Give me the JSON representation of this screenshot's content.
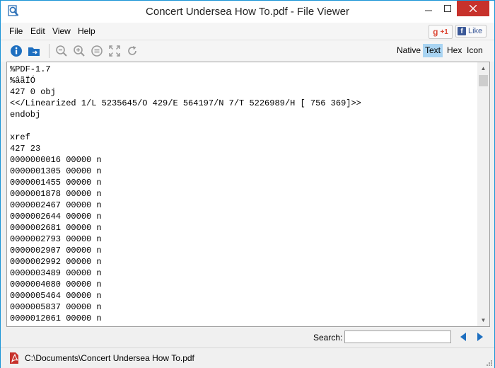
{
  "window": {
    "title": "Concert Undersea How To.pdf - File Viewer"
  },
  "titlebar_buttons": {
    "minimize": "—",
    "maximize": "☐",
    "close": "✕"
  },
  "menu": [
    "File",
    "Edit",
    "View",
    "Help"
  ],
  "social": {
    "gplus_label": "+1",
    "gplus_letter": "g",
    "facebook_label": "Like",
    "facebook_letter": "f"
  },
  "toolbar": {
    "icons": [
      "info-icon",
      "open-folder-icon",
      "zoom-out-icon",
      "zoom-in-icon",
      "zoom-reset-icon",
      "fit-to-window-icon",
      "rotate-icon"
    ],
    "view_tabs": [
      "Native",
      "Text",
      "Hex",
      "Icon"
    ],
    "active_view": "Text"
  },
  "content": {
    "lines": [
      "%PDF-1.7",
      "%âãÏÓ",
      "427 0 obj",
      "<</Linearized 1/L 5235645/O 429/E 564197/N 7/T 5226989/H [ 756 369]>>",
      "endobj",
      "",
      "xref",
      "427 23",
      "0000000016 00000 n",
      "0000001305 00000 n",
      "0000001455 00000 n",
      "0000001878 00000 n",
      "0000002467 00000 n",
      "0000002644 00000 n",
      "0000002681 00000 n",
      "0000002793 00000 n",
      "0000002907 00000 n",
      "0000002992 00000 n",
      "0000003489 00000 n",
      "0000004080 00000 n",
      "0000005464 00000 n",
      "0000005837 00000 n",
      "0000012061 00000 n"
    ]
  },
  "search": {
    "label": "Search:",
    "value": "",
    "placeholder": ""
  },
  "status": {
    "path": "C:\\Documents\\Concert Undersea How To.pdf"
  },
  "colors": {
    "accent": "#1a94d6",
    "close_button": "#c7312b",
    "active_tab": "#a9d4f2",
    "nav_arrow": "#1e6fc0"
  }
}
